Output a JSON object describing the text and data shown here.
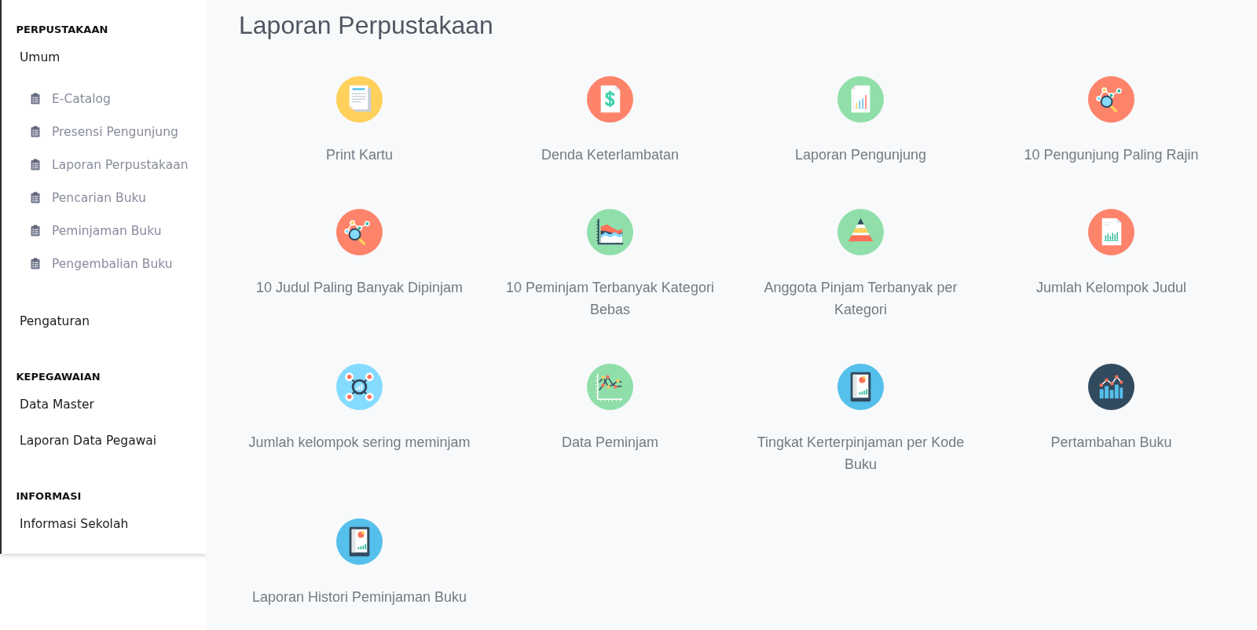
{
  "sidebar": {
    "sections": [
      {
        "heading": "PERPUSTAKAAN",
        "items": [
          {
            "label": "Umum",
            "children": [
              {
                "label": "E-Catalog"
              },
              {
                "label": "Presensi Pengunjung"
              },
              {
                "label": "Laporan Perpustakaan"
              },
              {
                "label": "Pencarian Buku"
              },
              {
                "label": "Peminjaman Buku"
              },
              {
                "label": "Pengembalian Buku"
              }
            ]
          },
          {
            "label": "Pengaturan"
          }
        ]
      },
      {
        "heading": "KEPEGAWAIAN",
        "items": [
          {
            "label": "Data Master"
          },
          {
            "label": "Laporan Data Pegawai"
          }
        ]
      },
      {
        "heading": "INFORMASI",
        "items": [
          {
            "label": "Informasi Sekolah"
          }
        ]
      }
    ]
  },
  "page": {
    "title": "Laporan Perpustakaan"
  },
  "reports": [
    {
      "label": "Print Kartu",
      "kind": "report"
    },
    {
      "label": "Denda Keterlambatan",
      "kind": "invoice"
    },
    {
      "label": "Laporan Pengunjung",
      "kind": "chartdoc"
    },
    {
      "label": "10 Pengunjung Paling Rajin",
      "kind": "magnifier"
    },
    {
      "label": "10 Judul Paling Banyak Dipinjam",
      "kind": "magnifier"
    },
    {
      "label": "10 Peminjam Terbanyak Kategori Bebas",
      "kind": "area"
    },
    {
      "label": "Anggota Pinjam Terbanyak per Kategori",
      "kind": "pyramid"
    },
    {
      "label": "Jumlah Kelompok Judul",
      "kind": "bardoc"
    },
    {
      "label": "Jumlah kelompok sering meminjam",
      "kind": "hub"
    },
    {
      "label": "Data Peminjam",
      "kind": "linechart"
    },
    {
      "label": "Tingkat Kerterpinjaman per Kode Buku",
      "kind": "tablet"
    },
    {
      "label": "Pertambahan Buku",
      "kind": "columns"
    },
    {
      "label": "Laporan Histori Peminjaman Buku",
      "kind": "tablet"
    }
  ]
}
